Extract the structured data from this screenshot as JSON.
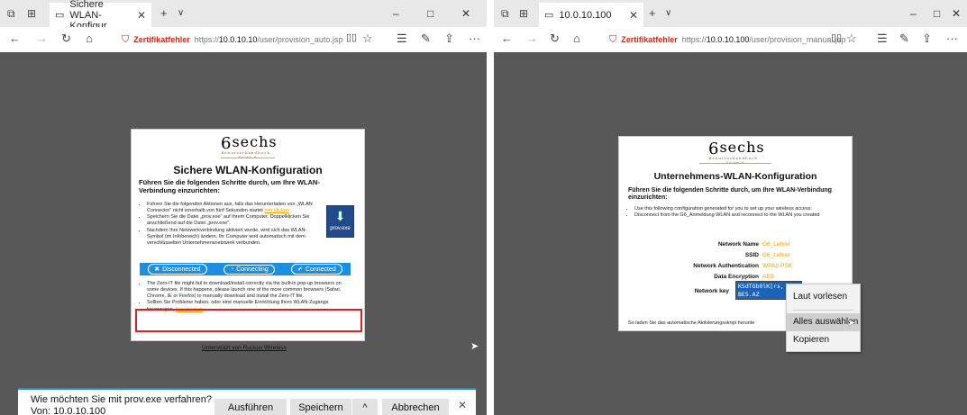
{
  "left": {
    "tab_title": "Sichere WLAN-Konfigur",
    "cert_label": "Zertifikatfehler",
    "url_prefix": "https://",
    "url_host": "10.0.10.10",
    "url_path": "/user/provision_auto.jsp",
    "title": "Sichere WLAN-Konfiguration",
    "subtitle": "Führen Sie die folgenden Schritte durch, um Ihre WLAN-Verbindung einzurichten:",
    "steps": [
      "Führen Sie die folgenden Aktionen aus, falls das Herunterladen von „WLAN Connector\" nicht innerhalb von fünf Sekunden startet",
      "Speichern Sie die Datei „prov.exe\" auf Ihrem Computer. Doppelklicken Sie anschließend auf die Datei „prov.exe\".",
      "Nachdem Ihre Netzwerkverbindung aktiviert wurde, wird sich das WLAN-Symbol (im Infobereich) ändern. Ihr Computer wird automatisch mit dem verschlüsselten Unternehmensnetzwerk verbunden."
    ],
    "step1_link": "hier klicken",
    "prov_label": "prov.exe",
    "states": [
      "Disconnected",
      "Connecting",
      "Connected"
    ],
    "note1": "The Zero-IT file might fail to download/install correctly via the built-in pop-up browsers on some devices. If this happens, please launch one of the more common browsers (Safari, Chrome, IE or Firefox) to manually download and install the Zero-IT file.",
    "note2": "Sollten Sie Probleme haben, oder eine manuelle Einrichtung Ihres WLAN-Zugangs bevorzugen,",
    "note2_link": "hier drücken",
    "powered": "Unterstützt von Ruckus Wireless",
    "download": {
      "question": "Wie möchten Sie mit prov.exe verfahren?",
      "from": "Von: 10.0.10.100",
      "run": "Ausführen",
      "save": "Speichern",
      "cancel": "Abbrechen"
    }
  },
  "right": {
    "tab_title": "10.0.10.100",
    "cert_label": "Zertifikatfehler",
    "url_prefix": "https://",
    "url_host": "10.0.10.100",
    "url_path": "/user/provision_manual.jsp",
    "title": "Unternehmens-WLAN-Konfiguration",
    "subtitle": "Führen Sie die folgenden Schritte durch, um Ihre WLAN-Verbindung einzurichten:",
    "steps": [
      "Use this following configuration generated for you to set up your wireless access:",
      "Disconnect from the G6_Anmeldung WLAN and reconnect to the WLAN you created"
    ],
    "fields": [
      {
        "label": "Network Name",
        "value": "G6_Lehrer"
      },
      {
        "label": "SSID",
        "value": "G6_Lehrer"
      },
      {
        "label": "Network Authentication",
        "value": "WPA2-PSK"
      },
      {
        "label": "Data Encryption",
        "value": "AES"
      }
    ],
    "key_label": "Network key",
    "key_line1": "KSdTOb0lK[rs,",
    "key_line2": "BE5.AZ",
    "footer": "So laden Sie das automatische Aktivierungsskript herunte",
    "context_menu": [
      "Laut vorlesen",
      "Alles auswählen",
      "Kopieren"
    ]
  },
  "logo": {
    "text": "sechs",
    "digit": "6",
    "tagline": "Benutzerhandbuch · Seite 6"
  },
  "window_controls": {
    "minimize": "–",
    "maximize": "□",
    "close": "✕"
  }
}
